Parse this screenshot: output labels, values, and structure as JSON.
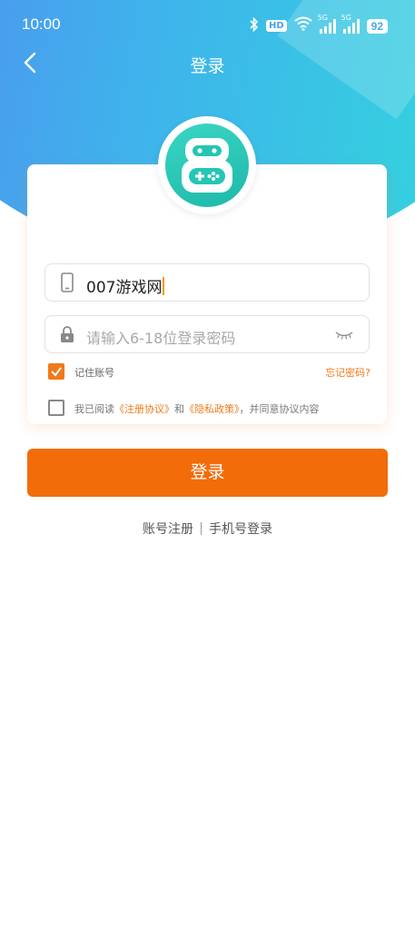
{
  "status_bar": {
    "time": "10:00",
    "hd_label": "HD",
    "signal_tag": "5G",
    "battery": "92"
  },
  "nav": {
    "title": "登录",
    "back_icon": "chevron-left-icon"
  },
  "logo": {
    "icon": "gamepad-robot-logo",
    "color": "#25c6b4"
  },
  "form": {
    "username_value": "007游戏网",
    "password_placeholder": "请输入6-18位登录密码",
    "remember_label": "记住账号",
    "remember_checked": true,
    "forgot_label": "忘记密码?",
    "agreement_checked": false,
    "agreement_prefix": "我已阅读",
    "agreement_link1": "《注册协议》",
    "agreement_and": "和",
    "agreement_link2": "《隐私政策》",
    "agreement_suffix": "，并同意协议内容"
  },
  "login_button": "登录",
  "bottom_links": {
    "register": "账号注册",
    "phone_login": "手机号登录"
  },
  "colors": {
    "accent": "#f26c0a",
    "gradient_start": "#5a7cf0",
    "gradient_end": "#2fe0d8"
  }
}
